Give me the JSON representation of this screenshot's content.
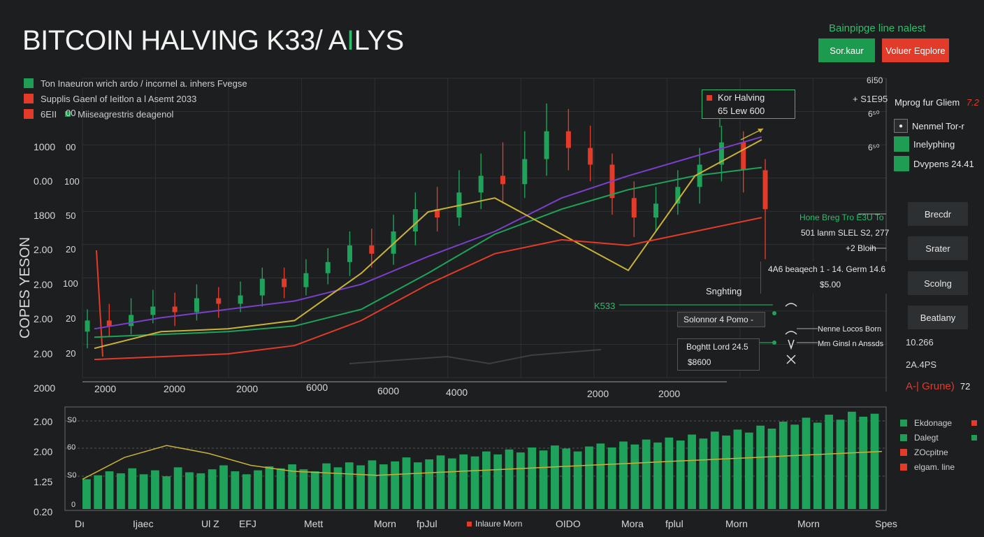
{
  "title": "BITCOIN HALVING K33/ A",
  "title_accent": "I",
  "title_tail": "LYS",
  "header": {
    "subtitle": "Bainpipge line nalest",
    "btn_green": "Sor.kaur",
    "btn_red": "Voluer Eqplore"
  },
  "legend": [
    {
      "label": "Ton Inaeuron wrich ardo / incornel a. inhers Fvegse",
      "color": "#1f9d55"
    },
    {
      "label": "Supplis   Gaenl of Ieitlon a l Asemt 2033",
      "color": "#e23b2a"
    },
    {
      "label": "6EII",
      "color": "#e23b2a"
    },
    {
      "label": "Miiseagrestris deagenol",
      "color": "#1f9d55"
    }
  ],
  "y_axis_outer": [
    "1000",
    "0.00",
    "1800",
    "2.00",
    "2.00",
    "2.00",
    "2.00",
    "2000"
  ],
  "y_axis_inner": [
    "00",
    "00",
    "100",
    "50",
    "20",
    "100",
    "20",
    "20"
  ],
  "y_axis_title": "COPES YESON",
  "x_axis_main": [
    "2000",
    "2000",
    "2000",
    "6000",
    "6000",
    "4000",
    "2000",
    "2000"
  ],
  "right_axis": [
    "6ⅰ50",
    "6⁵⁰",
    "6⁵⁰"
  ],
  "right_value": "+ S1E95",
  "right_panel": {
    "title": "Mprog fur Gliem",
    "title_suffix": "7.2",
    "items": [
      {
        "label": "Nenmel Tor-r",
        "color": "#2a2c2e"
      },
      {
        "label": "Inelyphing",
        "color": "#1f9d55"
      },
      {
        "label": "Dvypens 24.41",
        "color": "#1f9d55"
      }
    ],
    "buttons": [
      "Brecdr",
      "Srater",
      "Scolng",
      "Beatlany"
    ],
    "numbers": [
      "10.266",
      "2A.4PS"
    ],
    "footer": "A-| Grune)",
    "footer_suffix": "72"
  },
  "callouts": {
    "halving_title": "Kor Halving",
    "halving_value": "65 Lew 600",
    "mid_label": "Hone Breg Tro E3U To",
    "mid_value": "501 lanm SLEL S2, 277",
    "mid_pct": "+2 Bloih",
    "box_label": "4A6 beaqech 1 - 14. Germ 14.6",
    "box_value": "$5.00",
    "snapshot": "Snghting",
    "k33": "K533",
    "solomon": "Solonnor 4 Pomo -",
    "boght": "Boghtt Lord 24.5",
    "boght_value": "$8600",
    "note1": "Nenne Locos Born",
    "note2": "Mm Ginsl n Anssds"
  },
  "volume_axis_left": [
    "2.00",
    "2.00",
    "1.25",
    "0.20"
  ],
  "volume_axis_inner": [
    "S0",
    "60",
    "S0",
    "0"
  ],
  "volume_legend": [
    {
      "label": "Ekdonage",
      "color": "#1f9d55",
      "mark": "#e23b2a"
    },
    {
      "label": "Dalegt",
      "color": "#1f9d55",
      "mark": "#1f9d55"
    },
    {
      "label": "ZOcpitne",
      "color": "#e23b2a",
      "mark": ""
    },
    {
      "label": "elgam. line",
      "color": "#e23b2a",
      "mark": ""
    }
  ],
  "volume_x_axis": [
    "Dı",
    "Ijaec",
    "Ul Z",
    "EFJ",
    "Mett",
    "Morn",
    "fpJul",
    "Inlaure Morn",
    "OIDO",
    "Morа",
    "fplul",
    "Morn",
    "Morn",
    "Spes"
  ],
  "chart_data": {
    "type": "line",
    "title": "BITCOIN HALVING K33/ AILYS",
    "ylim": [
      0,
      100
    ],
    "series": [
      {
        "color": "#7b3fc9",
        "values": [
          15,
          19,
          22,
          25,
          31,
          41,
          50,
          62,
          70,
          77,
          84
        ]
      },
      {
        "color": "#1fa35a",
        "values": [
          12,
          13,
          14,
          16,
          22,
          35,
          49,
          58,
          65,
          70,
          73
        ]
      },
      {
        "color": "#c8b23a",
        "values": [
          8,
          14,
          15,
          18,
          35,
          57,
          62,
          49,
          36,
          70,
          83
        ]
      },
      {
        "color": "#e23b2a",
        "values": [
          4,
          5,
          6,
          9,
          18,
          31,
          42,
          47,
          45,
          50,
          55
        ]
      }
    ],
    "candles": [
      {
        "o": 14,
        "c": 18,
        "h": 22,
        "l": 8
      },
      {
        "o": 18,
        "c": 16,
        "h": 24,
        "l": 12
      },
      {
        "o": 16,
        "c": 20,
        "h": 26,
        "l": 13
      },
      {
        "o": 20,
        "c": 23,
        "h": 29,
        "l": 17
      },
      {
        "o": 23,
        "c": 21,
        "h": 28,
        "l": 16
      },
      {
        "o": 21,
        "c": 26,
        "h": 31,
        "l": 18
      },
      {
        "o": 26,
        "c": 24,
        "h": 30,
        "l": 19
      },
      {
        "o": 24,
        "c": 27,
        "h": 32,
        "l": 21
      },
      {
        "o": 27,
        "c": 33,
        "h": 37,
        "l": 23
      },
      {
        "o": 33,
        "c": 30,
        "h": 37,
        "l": 26
      },
      {
        "o": 30,
        "c": 35,
        "h": 40,
        "l": 27
      },
      {
        "o": 35,
        "c": 39,
        "h": 44,
        "l": 31
      },
      {
        "o": 39,
        "c": 45,
        "h": 50,
        "l": 34
      },
      {
        "o": 45,
        "c": 42,
        "h": 51,
        "l": 37
      },
      {
        "o": 42,
        "c": 50,
        "h": 56,
        "l": 38
      },
      {
        "o": 50,
        "c": 58,
        "h": 64,
        "l": 45
      },
      {
        "o": 58,
        "c": 55,
        "h": 66,
        "l": 50
      },
      {
        "o": 55,
        "c": 64,
        "h": 72,
        "l": 52
      },
      {
        "o": 64,
        "c": 70,
        "h": 78,
        "l": 58
      },
      {
        "o": 70,
        "c": 67,
        "h": 82,
        "l": 60
      },
      {
        "o": 67,
        "c": 76,
        "h": 86,
        "l": 62
      },
      {
        "o": 76,
        "c": 86,
        "h": 96,
        "l": 70
      },
      {
        "o": 86,
        "c": 80,
        "h": 94,
        "l": 72
      },
      {
        "o": 80,
        "c": 74,
        "h": 88,
        "l": 68
      },
      {
        "o": 74,
        "c": 62,
        "h": 78,
        "l": 56
      },
      {
        "o": 62,
        "c": 55,
        "h": 68,
        "l": 48
      },
      {
        "o": 55,
        "c": 60,
        "h": 66,
        "l": 50
      },
      {
        "o": 60,
        "c": 66,
        "h": 72,
        "l": 56
      },
      {
        "o": 66,
        "c": 74,
        "h": 80,
        "l": 60
      },
      {
        "o": 74,
        "c": 82,
        "h": 88,
        "l": 68
      },
      {
        "o": 82,
        "c": 72,
        "h": 86,
        "l": 64
      },
      {
        "o": 72,
        "c": 58,
        "h": 76,
        "l": 40
      }
    ],
    "volume": [
      30,
      34,
      38,
      36,
      41,
      35,
      39,
      33,
      42,
      37,
      36,
      40,
      44,
      38,
      35,
      39,
      43,
      41,
      45,
      40,
      38,
      46,
      42,
      47,
      44,
      49,
      45,
      48,
      52,
      47,
      50,
      54,
      51,
      55,
      53,
      58,
      55,
      60,
      57,
      62,
      59,
      64,
      61,
      58,
      63,
      66,
      62,
      68,
      65,
      70,
      67,
      72,
      69,
      75,
      71,
      78,
      74,
      80,
      77,
      84,
      81,
      88,
      85,
      92,
      87,
      95,
      90,
      98,
      93,
      96
    ],
    "volume_line": [
      30,
      52,
      64,
      56,
      44,
      38,
      36,
      34,
      36,
      38,
      40,
      42,
      44,
      46,
      48,
      50,
      52,
      54,
      56,
      58
    ]
  }
}
